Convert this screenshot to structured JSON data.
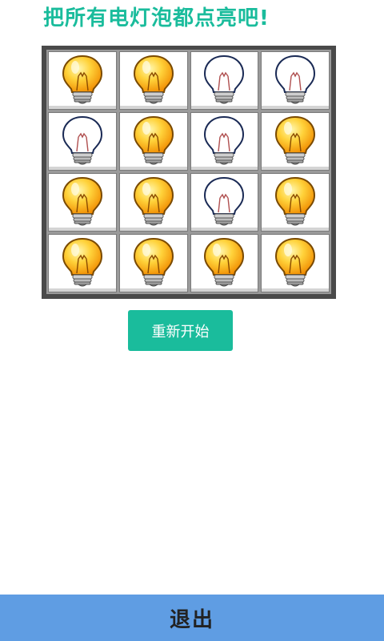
{
  "title": "把所有电灯泡都点亮吧!",
  "board": {
    "rows": [
      [
        "on",
        "on",
        "off",
        "off"
      ],
      [
        "off",
        "on",
        "off",
        "on"
      ],
      [
        "on",
        "on",
        "off",
        "on"
      ],
      [
        "on",
        "on",
        "on",
        "on"
      ]
    ]
  },
  "restart_label": "重新开始",
  "exit_label": "退出",
  "colors": {
    "accent": "#1abc9c",
    "exit_bar": "#5f9de3",
    "bulb_on": "#f7b733",
    "bulb_off": "#ffffff"
  },
  "icons": {
    "on": "lit-bulb-icon",
    "off": "unlit-bulb-icon"
  }
}
